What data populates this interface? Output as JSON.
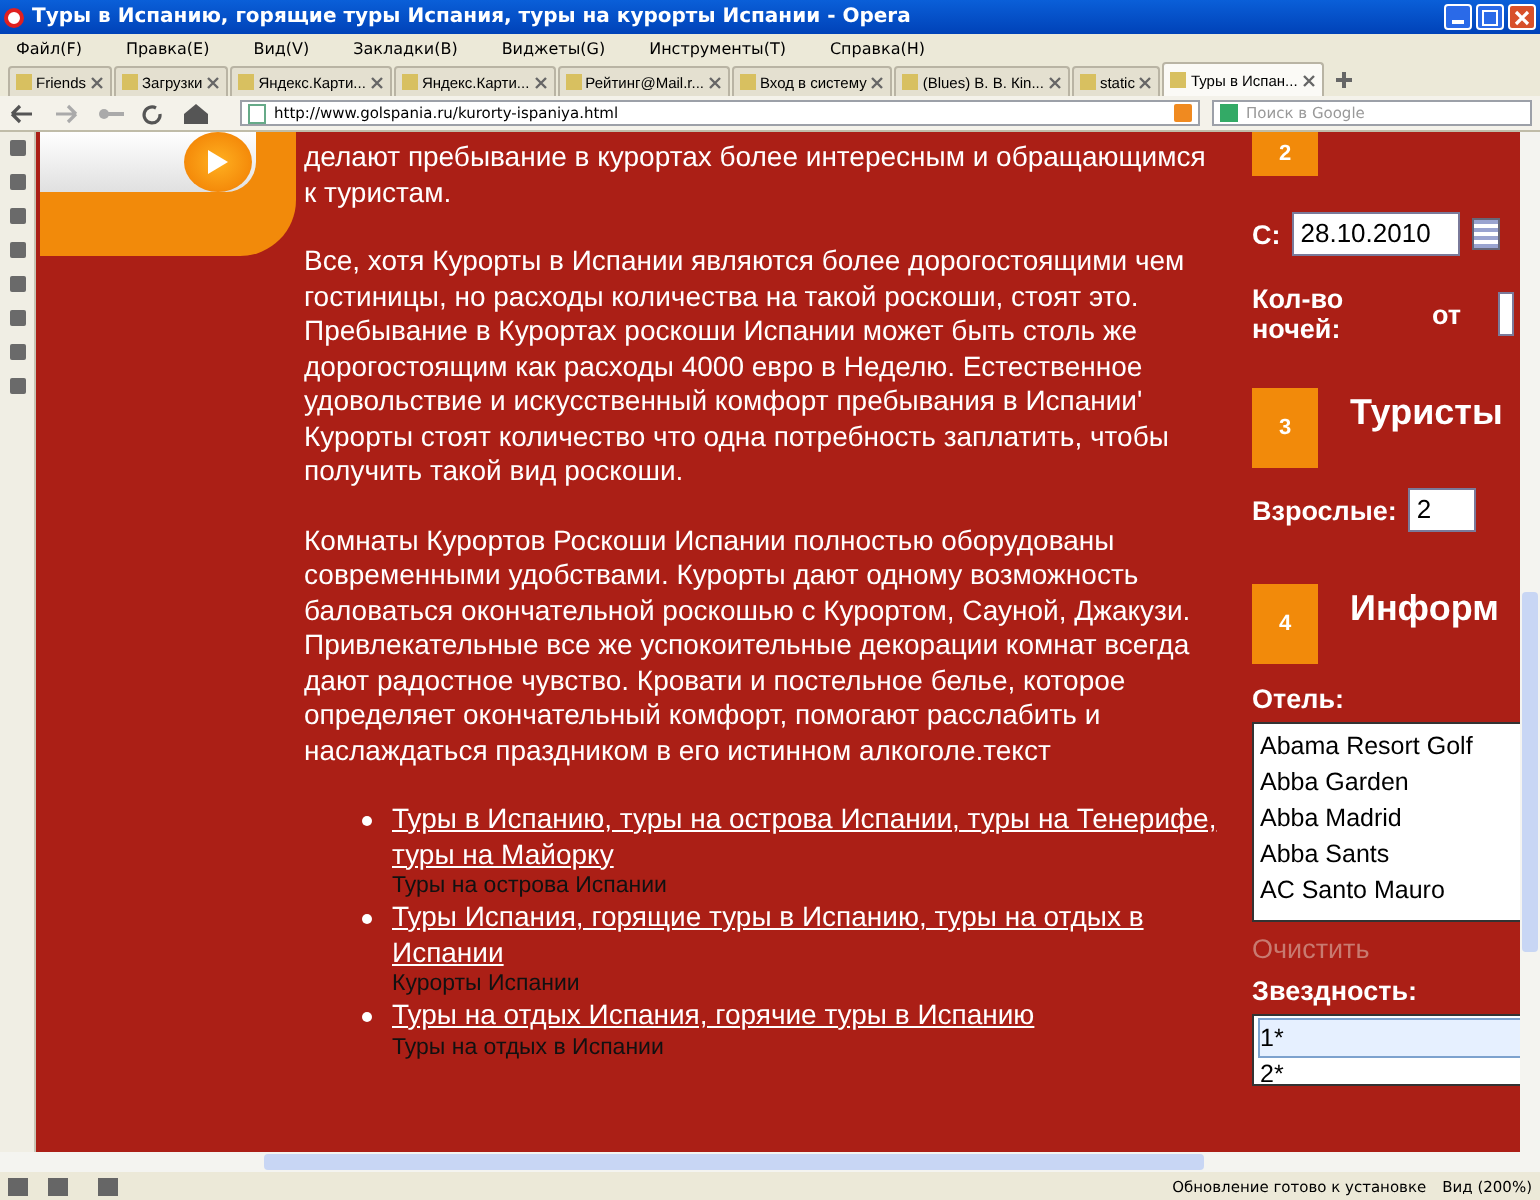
{
  "window": {
    "title": "Туры в Испанию, горящие туры Испания, туры на курорты Испании - Opera"
  },
  "menu": [
    "Файл(F)",
    "Правка(E)",
    "Вид(V)",
    "Закладки(B)",
    "Виджеты(G)",
    "Инструменты(T)",
    "Справка(H)"
  ],
  "tabs": [
    {
      "label": "Friends",
      "selected": false
    },
    {
      "label": "Загрузки",
      "selected": false
    },
    {
      "label": "Яндекс.Карти...",
      "selected": false
    },
    {
      "label": "Яндекс.Карти...",
      "selected": false
    },
    {
      "label": "Рейтинг@Mail.r...",
      "selected": false
    },
    {
      "label": "Вход в систему",
      "selected": false
    },
    {
      "label": "(Blues) В. В. Кin...",
      "selected": false
    },
    {
      "label": "static",
      "selected": false
    },
    {
      "label": "Туры в Испан...",
      "selected": true
    }
  ],
  "address_bar": {
    "url": "http://www.golspania.ru/kurorty-ispaniya.html"
  },
  "search": {
    "placeholder": "Поиск в Google"
  },
  "article": {
    "paragraphs": [
      "делают пребывание в курортах более интересным и обращающимся к туристам.",
      "Все, хотя Курорты в Испании являются более дорогостоящими чем гостиницы, но расходы количества на такой роскоши, стоят это. Пребывание в Курортах роскоши Испании может быть столь же дорогостоящим как расходы 4000 евро в Неделю. Естественное удовольствие и искусственный комфорт пребывания в Испании' Курорты стоят количество что одна потребность заплатить, чтобы получить такой вид роскоши.",
      "Комнаты Курортов Роскоши Испании полностью оборудованы современными удобствами. Курорты дают одному возможность баловаться окончательной роскошью с Курортом, Сауной, Джакузи. Привлекательные все же успокоительные декорации комнат всегда дают радостное чувство. Кровати и постельное белье, которое определяет окончательный комфорт, помогают расслабить и наслаждаться праздником в его истинном алкоголе.текст"
    ],
    "links": [
      {
        "label": "Туры в Испанию, туры на острова Испании, туры на Тенерифе, туры на Майорку",
        "caption": "Туры на острова Испании"
      },
      {
        "label": "Туры Испания, горящие туры в Испанию, туры на отдых в Испании",
        "caption": "Курорты Испании"
      },
      {
        "label": "Туры на отдых Испания, горячие туры в Испанию",
        "caption": "Туры на отдых в Испании"
      }
    ]
  },
  "search_form": {
    "step_2": {
      "number": "2",
      "date_label": "С:",
      "date_value": "28.10.2010",
      "nights_label": "Кол-во ночей:",
      "nights_from": "от"
    },
    "step_3": {
      "number": "3",
      "heading": "Туристы",
      "adults_label": "Взрослые:",
      "adults_value": "2"
    },
    "step_4": {
      "number": "4",
      "heading": "Информ",
      "hotel_label": "Отель:",
      "hotels": [
        {
          "label": "Abama Resort Golf",
          "selected": false
        },
        {
          "label": "Abba Garden",
          "selected": false
        },
        {
          "label": "Abba Madrid",
          "selected": false
        },
        {
          "label": "Abba Sants",
          "selected": false
        },
        {
          "label": "AC Santo Mauro",
          "selected": false
        }
      ],
      "clear_link": {
        "label": "Очистить",
        "disabled": true
      },
      "stars_label": "Звездность:",
      "stars_options": [
        {
          "label": "1*",
          "selected": true
        },
        {
          "label": "2*",
          "selected": false
        }
      ]
    }
  },
  "status_bar": {
    "message": "Обновление готово к установке",
    "zoom": "Вид (200%)"
  }
}
